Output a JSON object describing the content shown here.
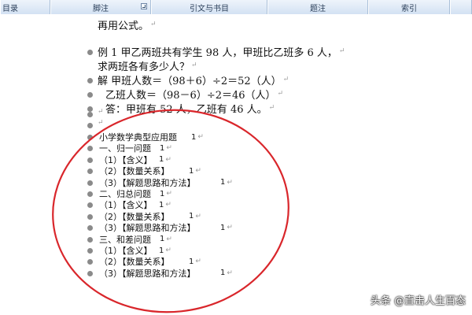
{
  "ribbon": {
    "groups": [
      "目录",
      "脚注",
      "引文与书目",
      "题注",
      "索引"
    ]
  },
  "doc": {
    "top_lines": [
      "再用公式。",
      "例 1 甲乙两班共有学生 98 人，甲班比乙班多 6 人，",
      "求两班各有多少人？",
      "解  甲班人数＝（98＋6）÷2＝52（人）",
      "乙班人数＝（98－6）÷2＝46（人）",
      "答：甲班有 52 人，乙班有 46 人。"
    ],
    "toc": [
      {
        "text": "小学数学典型应用题",
        "page": "1"
      },
      {
        "text": "一、归一问题",
        "page": "1"
      },
      {
        "text": "（1）【含义】",
        "page": "1"
      },
      {
        "text": "（2）【数量关系】",
        "page": "1"
      },
      {
        "text": "（3）【解题思路和方法】",
        "page": "1"
      },
      {
        "text": "二、归总问题",
        "page": "1"
      },
      {
        "text": "（1）【含义】",
        "page": "1"
      },
      {
        "text": "（2）【数量关系】",
        "page": "1"
      },
      {
        "text": "（3）【解题思路和方法】",
        "page": "1"
      },
      {
        "text": "三、和差问题",
        "page": "1"
      },
      {
        "text": "（1）【含义】",
        "page": "1"
      },
      {
        "text": "（2）【数量关系】",
        "page": "1"
      },
      {
        "text": "（3）【解题思路和方法】",
        "page": "1"
      }
    ],
    "paragraph_mark": "↵"
  },
  "watermark": "头条 @直击人生百态",
  "colors": {
    "annotation": "#d9262b",
    "bullet": "#8a8a8a"
  }
}
